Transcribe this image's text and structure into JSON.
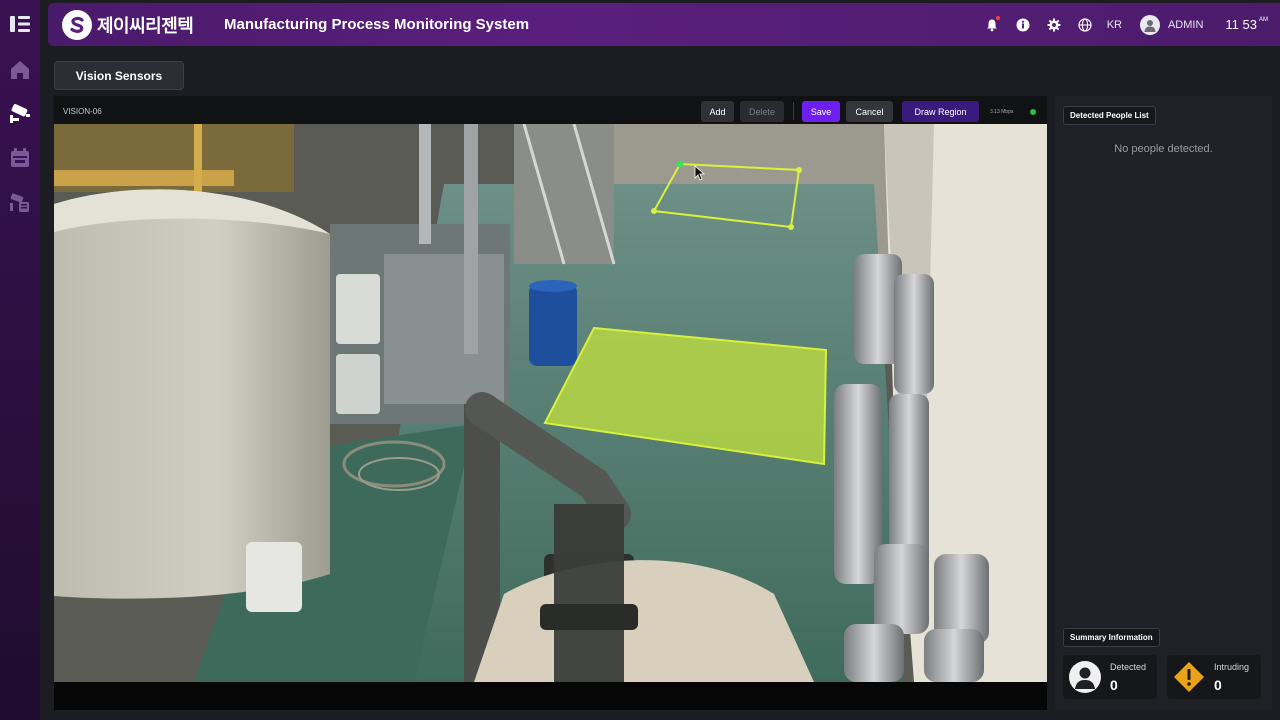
{
  "sidebar": {
    "items": [
      {
        "icon": "menu-icon"
      },
      {
        "icon": "home-icon"
      },
      {
        "icon": "cctv-camera-icon"
      },
      {
        "icon": "calendar-icon"
      },
      {
        "icon": "camera-settings-icon"
      }
    ]
  },
  "header": {
    "logo_text": "제이씨리젠텍",
    "title": "Manufacturing Process Monitoring System",
    "language": "KR",
    "user": "ADMIN",
    "time": "11 53",
    "time_suffix": "AM"
  },
  "section_tab": "Vision Sensors",
  "video": {
    "camera_id": "VISION-06",
    "toolbar": {
      "add": "Add",
      "delete": "Delete",
      "save": "Save",
      "cancel": "Cancel",
      "draw_region": "Draw Region"
    },
    "bitrate": "3.13 Mbps",
    "colors": {
      "region_fill": "#c8e63a",
      "region_stroke": "#d9f03c",
      "live": "#29c04a"
    }
  },
  "detected_panel": {
    "title": "Detected People List",
    "empty_message": "No people detected."
  },
  "summary": {
    "title": "Summary Information",
    "detected_label": "Detected",
    "detected_value": "0",
    "intruding_label": "Intruding",
    "intruding_value": "0",
    "colors": {
      "warning": "#e8a317"
    }
  }
}
